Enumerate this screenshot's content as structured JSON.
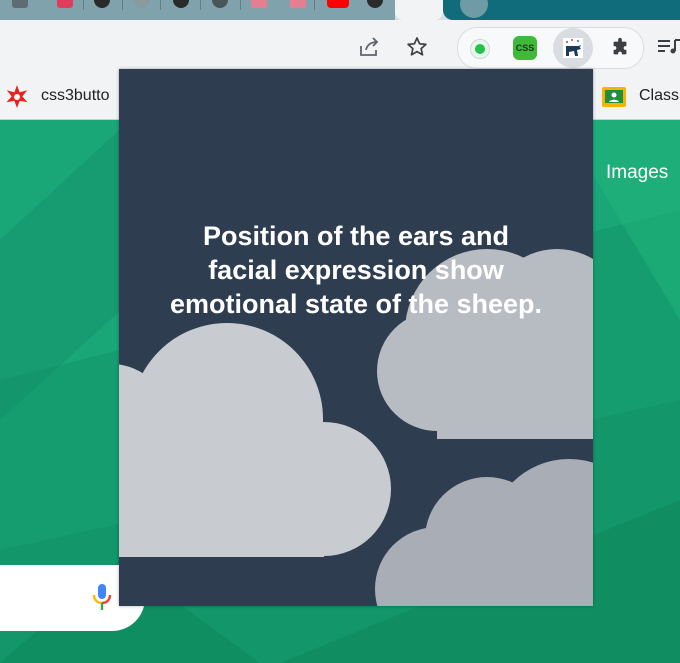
{
  "bookmarks": {
    "left_label": "css3butto",
    "right_label": "Class"
  },
  "page": {
    "images_link": "Images"
  },
  "popup": {
    "fact_text": "Position of the ears and facial expression show emotional state of the sheep."
  },
  "extensions": {
    "css_badge": "CSS"
  },
  "colors": {
    "popup_bg": "#2f3d51",
    "cloud_light": "#c8ccd1",
    "cloud_mid": "#b7bcc3",
    "cloud_dark": "#a9aeb6",
    "page_green": "#17a36d"
  },
  "icons": [
    "share-icon",
    "star-icon",
    "extensions-puzzle-icon",
    "reading-list-icon",
    "microphone-icon",
    "css3-bookmark-icon",
    "classroom-icon"
  ]
}
